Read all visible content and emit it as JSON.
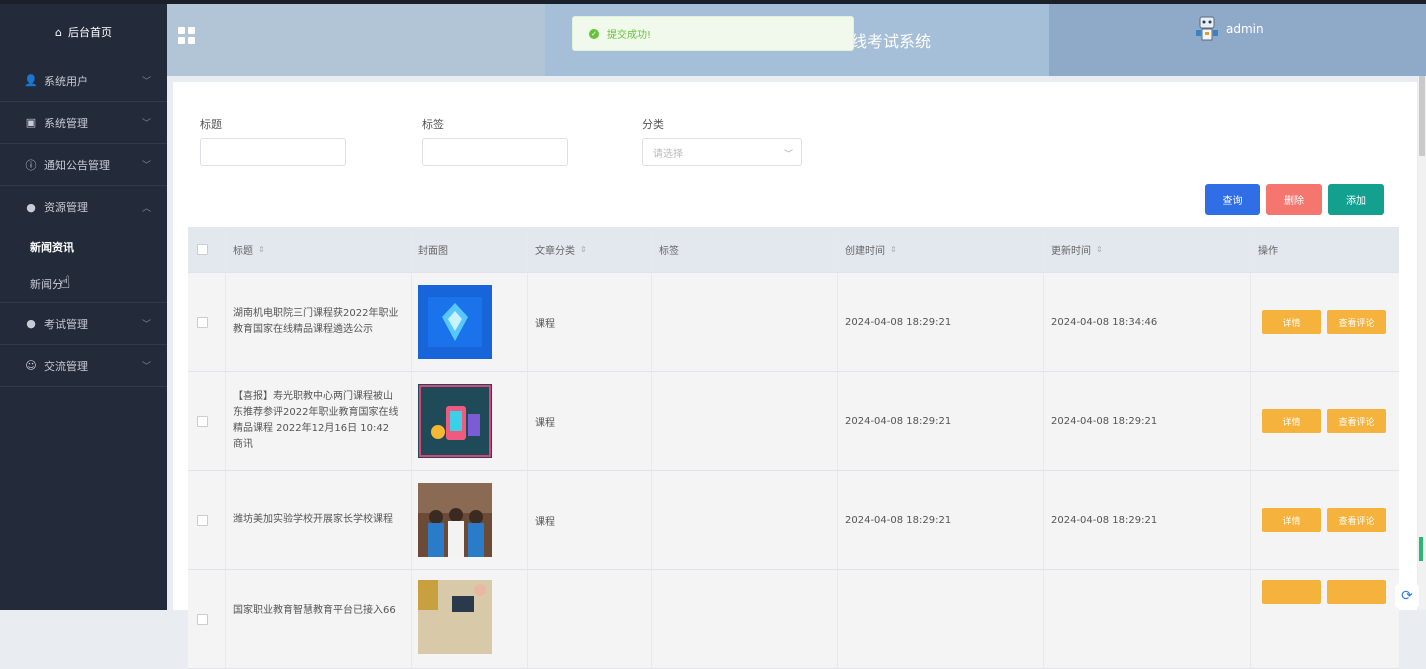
{
  "toast": {
    "message": "提交成功!"
  },
  "header": {
    "system_title": "线考试系统",
    "username": "admin"
  },
  "sidebar": {
    "home_label": "后台首页",
    "items": [
      {
        "label": "系统用户",
        "icon": "user-icon"
      },
      {
        "label": "系统管理",
        "icon": "image-icon"
      },
      {
        "label": "通知公告管理",
        "icon": "info-icon"
      },
      {
        "label": "资源管理",
        "icon": "location-icon"
      },
      {
        "label": "考试管理",
        "icon": "location-icon"
      },
      {
        "label": "交流管理",
        "icon": "chat-icon"
      }
    ],
    "sub_items": [
      {
        "label": "新闻资讯"
      },
      {
        "label": "新闻分"
      }
    ]
  },
  "filters": {
    "title_label": "标题",
    "tag_label": "标签",
    "category_label": "分类",
    "category_placeholder": "请选择"
  },
  "actions": {
    "query": "查询",
    "delete": "删除",
    "add": "添加"
  },
  "table": {
    "headers": {
      "title": "标题",
      "cover": "封面图",
      "category": "文章分类",
      "tag": "标签",
      "created": "创建时间",
      "updated": "更新时间",
      "ops": "操作"
    },
    "rows": [
      {
        "title": "湖南机电职院三门课程获2022年职业教育国家在线精品课程遴选公示",
        "category": "课程",
        "tag": "",
        "created": "2024-04-08 18:29:21",
        "updated": "2024-04-08 18:34:46"
      },
      {
        "title": "【喜报】寿光职教中心两门课程被山东推荐参评2022年职业教育国家在线精品课程 2022年12月16日 10:42 商讯",
        "category": "课程",
        "tag": "",
        "created": "2024-04-08 18:29:21",
        "updated": "2024-04-08 18:29:21"
      },
      {
        "title": "潍坊美加实验学校开展家长学校课程",
        "category": "课程",
        "tag": "",
        "created": "2024-04-08 18:29:21",
        "updated": "2024-04-08 18:29:21"
      },
      {
        "title": "国家职业教育智慧教育平台已接入66",
        "category": "",
        "tag": "",
        "created": "",
        "updated": ""
      }
    ],
    "op_detail": "详情",
    "op_review": "查看评论"
  },
  "colors": {
    "sidebar": "#232b3b",
    "primary": "#2f6ee5",
    "danger": "#f4766e",
    "success": "#14a08f",
    "warning": "#f5b23d"
  }
}
